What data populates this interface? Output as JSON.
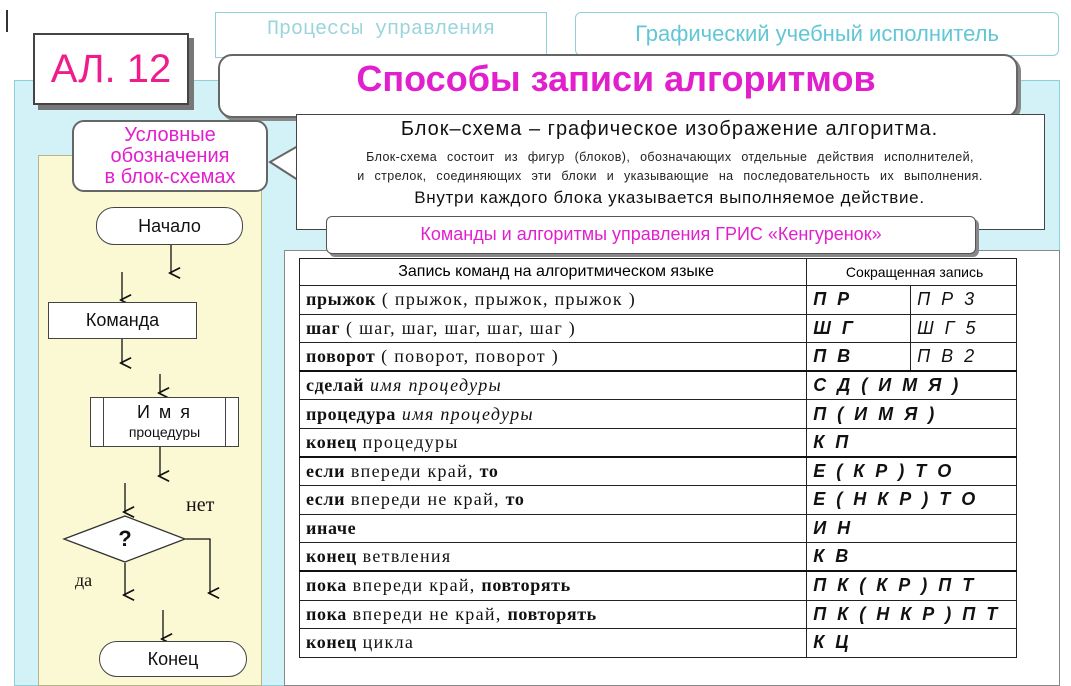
{
  "header": {
    "tab_left": "Процессы управления",
    "tab_right": "Графический учебный исполнитель",
    "badge": "АЛ. 12",
    "title": "Способы записи алгоритмов"
  },
  "callout": {
    "line1": "Условные",
    "line2": "обозначения",
    "line3": "в блок-схемах"
  },
  "definition": {
    "line1": "Блок–схема – графическое изображение алгоритма.",
    "line2": "Блок-схема состоит из фигур (блоков), обозначающих отдельные действия исполнителей,",
    "line3": "и стрелок, соединяющих эти блоки и указывающие на последовательность их выполнения.",
    "line4": "Внутри каждого блока указывается выполняемое действие."
  },
  "subtitle": "Команды и алгоритмы управления ГРИС «Кенгуренок»",
  "flowchart": {
    "start": "Начало",
    "command": "Команда",
    "proc_line1": "И м я",
    "proc_line2": "процедуры",
    "decision": "?",
    "no": "нет",
    "yes": "да",
    "end": "Конец"
  },
  "table": {
    "header_main": "Запись команд на алгоритмическом языке",
    "header_short": "Сокращенная запись",
    "rows": [
      {
        "kw": "прыжок",
        "rest": " ( прыжок, прыжок, прыжок )",
        "short1": "П Р",
        "short2": "П Р 3"
      },
      {
        "kw": "шаг",
        "rest": " ( шаг, шаг, шаг, шаг, шаг )",
        "short1": "Ш Г",
        "short2": "Ш Г 5"
      },
      {
        "kw": "поворот",
        "rest": " ( поворот, поворот )",
        "short1": "П В",
        "short2": "П В 2"
      },
      {
        "kw": "сделай",
        "rest": " имя процедуры",
        "short1": "С Д ( И М Я )"
      },
      {
        "kw": "процедура",
        "rest": " имя процедуры",
        "short1": "П ( И М Я )"
      },
      {
        "kw": "конец",
        "rest": " процедуры",
        "short1": "К П"
      },
      {
        "kw": "если",
        "rest": " впереди край,",
        "kw2": "то",
        "short1": "Е ( К Р ) Т О"
      },
      {
        "kw": "если",
        "rest": " впереди не край,",
        "kw2": "то",
        "short1": "Е ( Н К Р ) Т О"
      },
      {
        "kw": "иначе",
        "rest": "",
        "short1": "И Н"
      },
      {
        "kw": "конец",
        "rest": " ветвления",
        "short1": "К В"
      },
      {
        "kw": "пока",
        "rest": " впереди край,",
        "kw2": "повторять",
        "short1": "П К ( К Р ) П Т"
      },
      {
        "kw": "пока",
        "rest": " впереди не край,",
        "kw2": "повторять",
        "short1": "П К ( Н К Р ) П Т"
      },
      {
        "kw": "конец",
        "rest": " цикла",
        "short1": "К Ц"
      }
    ]
  }
}
